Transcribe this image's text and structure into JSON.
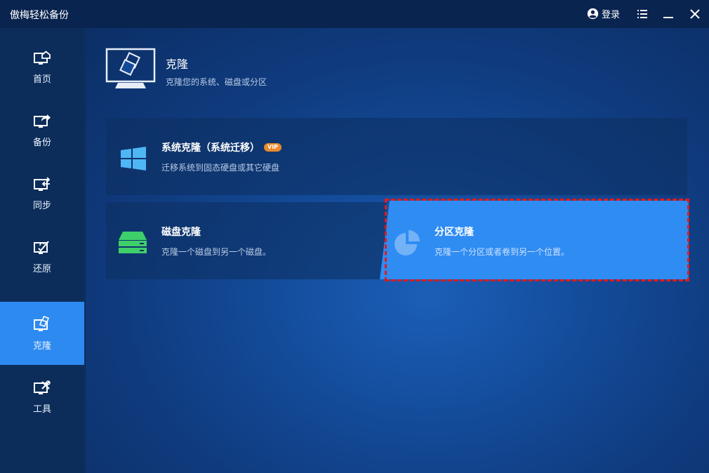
{
  "app": {
    "title": "傲梅轻松备份",
    "login_label": "登录"
  },
  "sidebar": {
    "items": [
      {
        "label": "首页",
        "icon": "home-icon"
      },
      {
        "label": "备份",
        "icon": "backup-icon"
      },
      {
        "label": "同步",
        "icon": "sync-icon"
      },
      {
        "label": "还原",
        "icon": "restore-icon"
      },
      {
        "label": "克隆",
        "icon": "clone-icon",
        "active": true
      },
      {
        "label": "工具",
        "icon": "tools-icon"
      }
    ]
  },
  "page": {
    "title": "克隆",
    "subtitle": "克隆您的系统、磁盘或分区"
  },
  "cards": {
    "system": {
      "title": "系统克隆（系统迁移）",
      "badge": "VIP",
      "desc": "迁移系统到固态硬盘或其它硬盘",
      "icon": "windows-icon"
    },
    "disk": {
      "title": "磁盘克隆",
      "desc": "克隆一个磁盘到另一个磁盘。",
      "icon": "disk-icon"
    },
    "partition": {
      "title": "分区克隆",
      "desc": "克隆一个分区或者卷到另一个位置。",
      "icon": "partition-icon"
    }
  },
  "colors": {
    "accent": "#2d8af0",
    "highlight_border": "#e21b1b",
    "vip_badge": "#e88a2a",
    "disk_icon": "#3ecf6a",
    "windows_icon": "#4fb6f5"
  }
}
